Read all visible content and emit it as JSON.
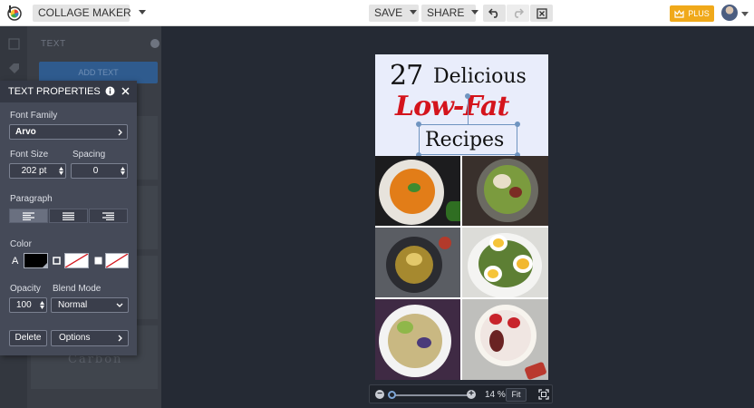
{
  "topbar": {
    "app_menu_label": "COLLAGE MAKER",
    "save_label": "SAVE",
    "share_label": "SHARE",
    "plus_label": "PLUS",
    "icons": [
      "logo-icon",
      "undo-icon",
      "redo-icon",
      "close-icon",
      "crown-icon",
      "avatar"
    ]
  },
  "sidebar": {
    "title": "TEXT",
    "add_text_label": "ADD TEXT",
    "sample_font_text": "Carbon"
  },
  "panel": {
    "title": "TEXT PROPERTIES",
    "font_family_label": "Font Family",
    "font_family_value": "Arvo",
    "font_size_label": "Font Size",
    "font_size_value": "202 pt",
    "spacing_label": "Spacing",
    "spacing_value": "0",
    "paragraph_label": "Paragraph",
    "alignments": [
      "align-left",
      "align-center",
      "align-right"
    ],
    "active_alignment": "align-left",
    "color_label": "Color",
    "color_text_glyph": "A",
    "text_color": "#000000",
    "opacity_label": "Opacity",
    "opacity_value": "100",
    "blend_mode_label": "Blend Mode",
    "blend_mode_value": "Normal",
    "delete_label": "Delete",
    "options_label": "Options"
  },
  "canvas": {
    "line1_number": "27",
    "line1_word": "Delicious",
    "line2": "Low-Fat",
    "line3": "Recipes",
    "accent_color": "#d4141c",
    "header_bg": "#e9edfb"
  },
  "zoom": {
    "percent": "14 %",
    "fit_label": "Fit",
    "level": 0.14
  },
  "colors": {
    "topbar": "#ffffff",
    "workspace": "#252a34",
    "panel": "#454a58",
    "plus": "#f0a91a",
    "selection": "#6f94c0"
  }
}
